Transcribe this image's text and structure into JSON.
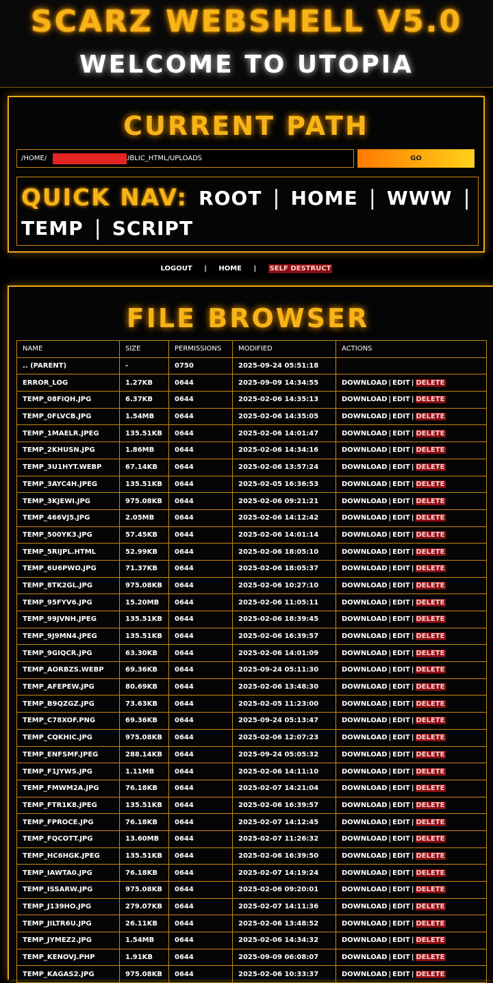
{
  "header": {
    "title": "SCARZ WEBSHELL v5.0",
    "subtitle": "WELCOME TO UTOPIA"
  },
  "path_panel": {
    "heading": "CURRENT PATH",
    "path_value_prefix": "/HOME/",
    "path_value_suffix": "PUBLIC_HTML/UPLOADS",
    "go_label": "GO",
    "quick_nav_label": "QUICK NAV:",
    "quick_nav_links": [
      "ROOT",
      "HOME",
      "WWW",
      "TEMP",
      "SCRIPT"
    ],
    "separator": "|"
  },
  "top_links": {
    "logout": "LOGOUT",
    "home": "HOME",
    "self_destruct": "SELF DESTRUCT",
    "separator": "|"
  },
  "file_browser": {
    "heading": "FILE BROWSER",
    "columns": [
      "NAME",
      "SIZE",
      "PERMISSIONS",
      "MODIFIED",
      "ACTIONS"
    ],
    "actions": {
      "download": "DOWNLOAD",
      "edit": "EDIT",
      "delete": "DELETE",
      "separator": "|"
    },
    "rows": [
      [
        ".. (PARENT)",
        "-",
        "0750",
        "2025-09-24 05:51:18",
        false
      ],
      [
        "ERROR_LOG",
        "1.27KB",
        "0644",
        "2025-09-09 14:34:55",
        true
      ],
      [
        "TEMP_08FIQH.JPG",
        "6.37KB",
        "0644",
        "2025-02-06 14:35:13",
        true
      ],
      [
        "TEMP_0FLVCB.JPG",
        "1.54MB",
        "0644",
        "2025-02-06 14:35:05",
        true
      ],
      [
        "TEMP_1MAELR.JPEG",
        "135.51KB",
        "0644",
        "2025-02-06 14:01:47",
        true
      ],
      [
        "TEMP_2KHUSN.JPG",
        "1.86MB",
        "0644",
        "2025-02-06 14:34:16",
        true
      ],
      [
        "TEMP_3U1HYT.WEBP",
        "67.14KB",
        "0644",
        "2025-02-06 13:57:24",
        true
      ],
      [
        "TEMP_3AYC4H.JPEG",
        "135.51KB",
        "0644",
        "2025-02-05 16:36:53",
        true
      ],
      [
        "TEMP_3KJEWI.JPG",
        "975.08KB",
        "0644",
        "2025-02-06 09:21:21",
        true
      ],
      [
        "TEMP_466VJ5.JPG",
        "2.05MB",
        "0644",
        "2025-02-06 14:12:42",
        true
      ],
      [
        "TEMP_500YK3.JPG",
        "57.45KB",
        "0644",
        "2025-02-06 14:01:14",
        true
      ],
      [
        "TEMP_5RIJPL.HTML",
        "52.99KB",
        "0644",
        "2025-02-06 18:05:10",
        true
      ],
      [
        "TEMP_6U6PWO.JPG",
        "71.37KB",
        "0644",
        "2025-02-06 18:05:37",
        true
      ],
      [
        "TEMP_8TK2GL.JPG",
        "975.08KB",
        "0644",
        "2025-02-06 10:27:10",
        true
      ],
      [
        "TEMP_95FYV6.JPG",
        "15.20MB",
        "0644",
        "2025-02-06 11:05:11",
        true
      ],
      [
        "TEMP_99JVNH.JPEG",
        "135.51KB",
        "0644",
        "2025-02-06 18:39:45",
        true
      ],
      [
        "TEMP_9J9MN4.JPEG",
        "135.51KB",
        "0644",
        "2025-02-06 16:39:57",
        true
      ],
      [
        "TEMP_9GIQCR.JPG",
        "63.30KB",
        "0644",
        "2025-02-06 14:01:09",
        true
      ],
      [
        "TEMP_AORBZS.WEBP",
        "69.36KB",
        "0644",
        "2025-09-24 05:11:30",
        true
      ],
      [
        "TEMP_AFEPEW.JPG",
        "80.69KB",
        "0644",
        "2025-02-06 13:48:30",
        true
      ],
      [
        "TEMP_B9QZGZ.JPG",
        "73.63KB",
        "0644",
        "2025-02-05 11:23:00",
        true
      ],
      [
        "TEMP_C78XOF.PNG",
        "69.36KB",
        "0644",
        "2025-09-24 05:13:47",
        true
      ],
      [
        "TEMP_CQKHIC.JPG",
        "975.08KB",
        "0644",
        "2025-02-06 12:07:23",
        true
      ],
      [
        "TEMP_ENFSMF.JPEG",
        "288.14KB",
        "0644",
        "2025-09-24 05:05:32",
        true
      ],
      [
        "TEMP_F1JYWS.JPG",
        "1.11MB",
        "0644",
        "2025-02-06 14:11:10",
        true
      ],
      [
        "TEMP_FMWM2A.JPG",
        "76.18KB",
        "0644",
        "2025-02-07 14:21:04",
        true
      ],
      [
        "TEMP_FTR1K8.JPEG",
        "135.51KB",
        "0644",
        "2025-02-06 16:39:57",
        true
      ],
      [
        "TEMP_FPROCE.JPG",
        "76.18KB",
        "0644",
        "2025-02-07 14:12:45",
        true
      ],
      [
        "TEMP_FQCOTT.JPG",
        "13.60MB",
        "0644",
        "2025-02-07 11:26:32",
        true
      ],
      [
        "TEMP_HC6HGK.JPEG",
        "135.51KB",
        "0644",
        "2025-02-06 16:39:50",
        true
      ],
      [
        "TEMP_IAWTA0.JPG",
        "76.18KB",
        "0644",
        "2025-02-07 14:19:24",
        true
      ],
      [
        "TEMP_ISSARW.JPG",
        "975.08KB",
        "0644",
        "2025-02-06 09:20:01",
        true
      ],
      [
        "TEMP_J139HO.JPG",
        "279.07KB",
        "0644",
        "2025-02-07 14:11:36",
        true
      ],
      [
        "TEMP_JILTR6U.JPG",
        "26.11KB",
        "0644",
        "2025-02-06 13:48:52",
        true
      ],
      [
        "TEMP_JYMEZ2.JPG",
        "1.54MB",
        "0644",
        "2025-02-06 14:34:32",
        true
      ],
      [
        "TEMP_KENOVJ.PHP",
        "1.91KB",
        "0644",
        "2025-09-09 06:08:07",
        true
      ],
      [
        "TEMP_KAGAS2.JPG",
        "975.08KB",
        "0644",
        "2025-02-06 10:33:37",
        true
      ]
    ]
  }
}
